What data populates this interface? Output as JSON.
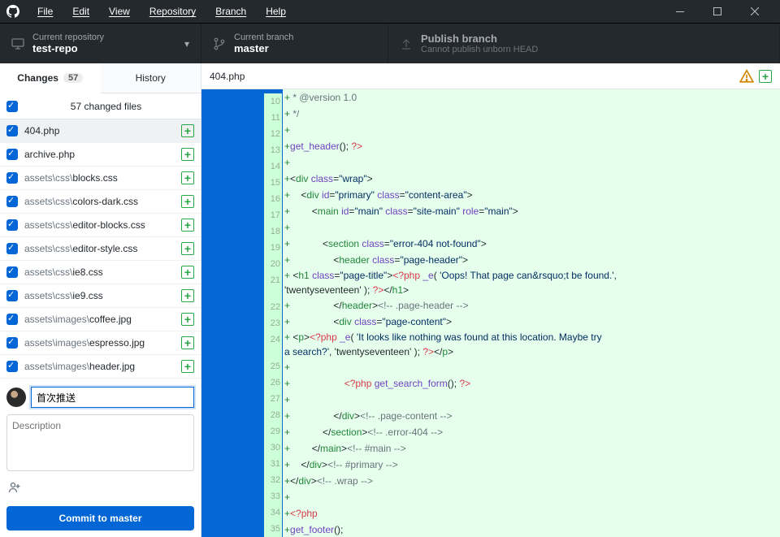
{
  "menu": [
    "File",
    "Edit",
    "View",
    "Repository",
    "Branch",
    "Help"
  ],
  "repo": {
    "label": "Current repository",
    "name": "test-repo"
  },
  "branch": {
    "label": "Current branch",
    "name": "master"
  },
  "publish": {
    "title": "Publish branch",
    "sub": "Cannot publish unborn HEAD"
  },
  "tabs": {
    "changes": "Changes",
    "changesCount": "57",
    "history": "History"
  },
  "allFiles": "57 changed files",
  "files": [
    {
      "pre": "",
      "name": "404.php",
      "sel": true
    },
    {
      "pre": "",
      "name": "archive.php"
    },
    {
      "pre": "assets\\css\\",
      "name": "blocks.css"
    },
    {
      "pre": "assets\\css\\",
      "name": "colors-dark.css"
    },
    {
      "pre": "assets\\css\\",
      "name": "editor-blocks.css"
    },
    {
      "pre": "assets\\css\\",
      "name": "editor-style.css"
    },
    {
      "pre": "assets\\css\\",
      "name": "ie8.css"
    },
    {
      "pre": "assets\\css\\",
      "name": "ie9.css"
    },
    {
      "pre": "assets\\images\\",
      "name": "coffee.jpg"
    },
    {
      "pre": "assets\\images\\",
      "name": "espresso.jpg"
    },
    {
      "pre": "assets\\images\\",
      "name": "header.jpg"
    }
  ],
  "commit": {
    "summary": "首次推送",
    "descPlaceholder": "Description",
    "btnPrefix": "Commit to ",
    "btnBranch": "master"
  },
  "diff": {
    "filename": "404.php",
    "lines": [
      {
        "n": 10,
        "raw": " * @version 1.0",
        "cls": "cmt"
      },
      {
        "n": 11,
        "raw": " */",
        "cls": "cmt"
      },
      {
        "n": 12,
        "raw": ""
      },
      {
        "n": 13,
        "html": "<span class='fn'>get_header</span>(); <span class='op'>?&gt;</span>"
      },
      {
        "n": 14,
        "raw": ""
      },
      {
        "n": 15,
        "html": "&lt;<span class='tag'>div</span> <span class='attr'>class</span>=<span class='str'>\"wrap\"</span>&gt;"
      },
      {
        "n": 16,
        "html": "    &lt;<span class='tag'>div</span> <span class='attr'>id</span>=<span class='str'>\"primary\"</span> <span class='attr'>class</span>=<span class='str'>\"content-area\"</span>&gt;"
      },
      {
        "n": 17,
        "html": "        &lt;<span class='tag'>main</span> <span class='attr'>id</span>=<span class='str'>\"main\"</span> <span class='attr'>class</span>=<span class='str'>\"site-main\"</span> <span class='attr'>role</span>=<span class='str'>\"main\"</span>&gt;"
      },
      {
        "n": 18,
        "raw": ""
      },
      {
        "n": 19,
        "html": "            &lt;<span class='tag'>section</span> <span class='attr'>class</span>=<span class='str'>\"error-404 not-found\"</span>&gt;"
      },
      {
        "n": 20,
        "html": "                &lt;<span class='tag'>header</span> <span class='attr'>class</span>=<span class='str'>\"page-header\"</span>&gt;"
      },
      {
        "n": 21,
        "html": "                    &lt;<span class='tag'>h1</span> <span class='attr'>class</span>=<span class='str'>\"page-title\"</span>&gt;<span class='op'>&lt;?php</span> <span class='fn'>_e</span>( <span class='str'>'Oops! That page can&amp;rsquo;t be found.'</span>,<br>'twentyseventeen' ); <span class='op'>?&gt;</span>&lt;/<span class='tag'>h1</span>&gt;",
        "tall": true
      },
      {
        "n": 22,
        "html": "                &lt;/<span class='tag'>header</span>&gt;<span class='cmt'>&lt;!-- .page-header --&gt;</span>"
      },
      {
        "n": 23,
        "html": "                &lt;<span class='tag'>div</span> <span class='attr'>class</span>=<span class='str'>\"page-content\"</span>&gt;"
      },
      {
        "n": 24,
        "html": "                    &lt;<span class='tag'>p</span>&gt;<span class='op'>&lt;?php</span> <span class='fn'>_e</span>( <span class='str'>'It looks like nothing was found at this location. Maybe try<br>a search?'</span>, 'twentyseventeen' ); <span class='op'>?&gt;</span>&lt;/<span class='tag'>p</span>&gt;",
        "tall": true
      },
      {
        "n": 25,
        "raw": ""
      },
      {
        "n": 26,
        "html": "                    <span class='op'>&lt;?php</span> <span class='fn'>get_search_form</span>(); <span class='op'>?&gt;</span>"
      },
      {
        "n": 27,
        "raw": ""
      },
      {
        "n": 28,
        "html": "                &lt;/<span class='tag'>div</span>&gt;<span class='cmt'>&lt;!-- .page-content --&gt;</span>"
      },
      {
        "n": 29,
        "html": "            &lt;/<span class='tag'>section</span>&gt;<span class='cmt'>&lt;!-- .error-404 --&gt;</span>"
      },
      {
        "n": 30,
        "html": "        &lt;/<span class='tag'>main</span>&gt;<span class='cmt'>&lt;!-- #main --&gt;</span>"
      },
      {
        "n": 31,
        "html": "    &lt;/<span class='tag'>div</span>&gt;<span class='cmt'>&lt;!-- #primary --&gt;</span>"
      },
      {
        "n": 32,
        "html": "&lt;/<span class='tag'>div</span>&gt;<span class='cmt'>&lt;!-- .wrap --&gt;</span>"
      },
      {
        "n": 33,
        "raw": ""
      },
      {
        "n": 34,
        "html": "<span class='op'>&lt;?php</span>"
      },
      {
        "n": 35,
        "html": "<span class='fn'>get_footer</span>();"
      }
    ]
  }
}
